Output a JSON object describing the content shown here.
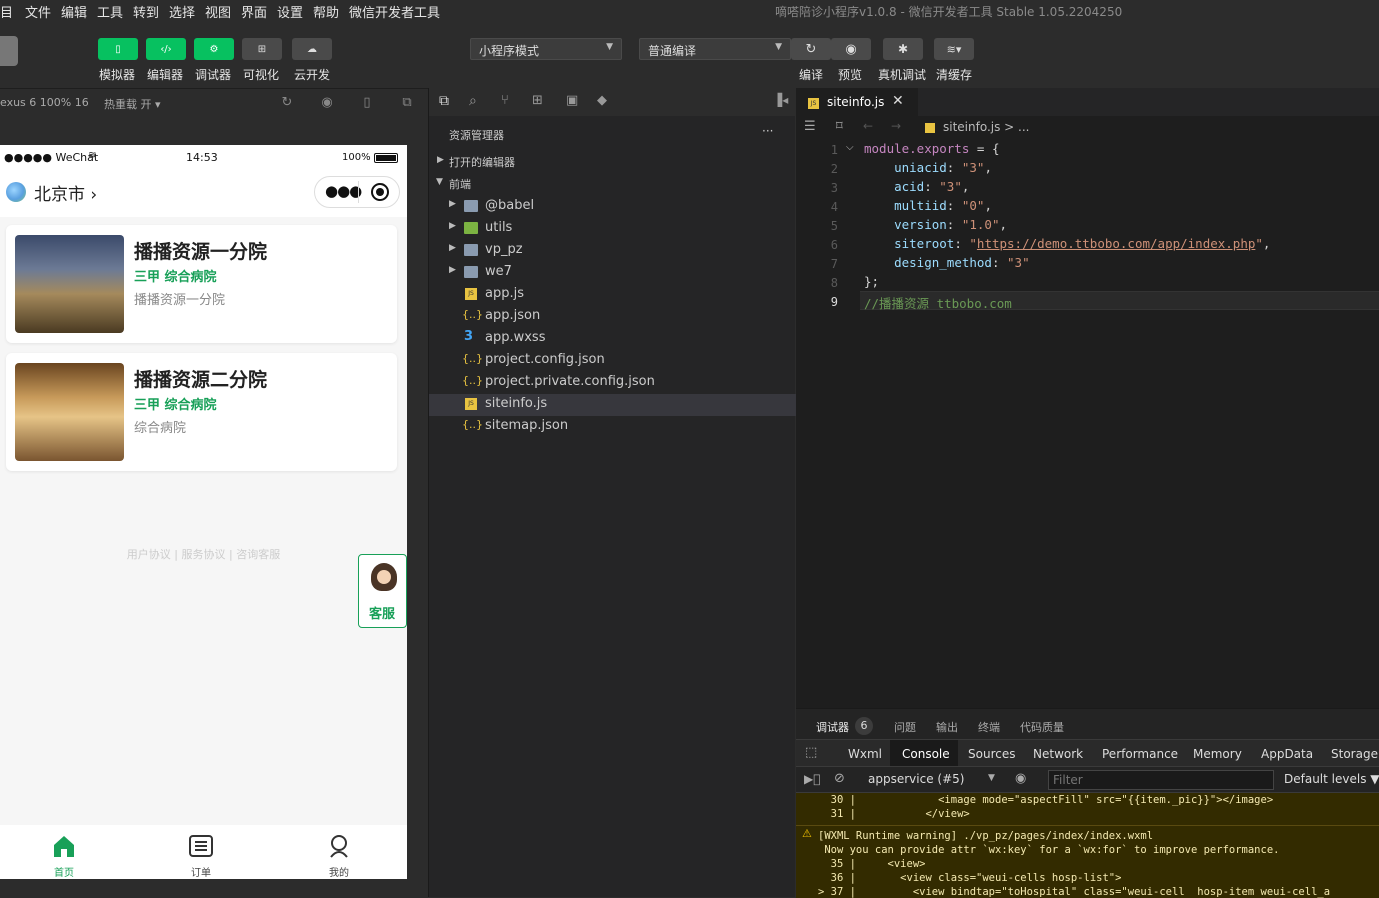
{
  "menubar": {
    "items": [
      "目",
      "文件",
      "编辑",
      "工具",
      "转到",
      "选择",
      "视图",
      "界面",
      "设置",
      "帮助",
      "微信开发者工具"
    ],
    "window_title": "嘀嗒陪诊小程序v1.0.8 - 微信开发者工具 Stable 1.05.2204250"
  },
  "toolbar": {
    "left_buttons": [
      {
        "label": "模拟器",
        "icon": "phone-icon"
      },
      {
        "label": "编辑器",
        "icon": "code-icon"
      },
      {
        "label": "调试器",
        "icon": "debug-icon"
      },
      {
        "label": "可视化",
        "icon": "layout-icon"
      },
      {
        "label": "云开发",
        "icon": "cloud-icon"
      }
    ],
    "mode_select": "小程序模式",
    "compile_select": "普通编译",
    "right_buttons": [
      {
        "label": "编译",
        "icon": "refresh-icon"
      },
      {
        "label": "预览",
        "icon": "eye-icon"
      },
      {
        "label": "真机调试",
        "icon": "bug-icon"
      },
      {
        "label": "清缓存",
        "icon": "layers-icon"
      }
    ]
  },
  "simbar": {
    "device": "exus 6 100% 16",
    "hotreload": "热重载 开"
  },
  "phone": {
    "status": {
      "carrier": "●●●●● WeChat",
      "time": "14:53",
      "battery": "100%"
    },
    "city": "北京市",
    "cards": [
      {
        "title": "播播资源一分院",
        "tags": "三甲  综合病院",
        "desc": "播播资源一分院"
      },
      {
        "title": "播播资源二分院",
        "tags": "三甲  综合病院",
        "desc": "综合病院"
      }
    ],
    "footer_links": "用户协议 | 服务协议 | 咨询客服",
    "kefu_label": "客服",
    "tabs": [
      {
        "label": "首页",
        "icon": "home-icon",
        "active": true
      },
      {
        "label": "订单",
        "icon": "list-icon",
        "active": false
      },
      {
        "label": "我的",
        "icon": "user-icon",
        "active": false
      }
    ]
  },
  "explorer": {
    "title": "资源管理器",
    "more": "···",
    "open_editors": "打开的编辑器",
    "project": "前端",
    "files": [
      {
        "name": "@babel",
        "type": "folder"
      },
      {
        "name": "utils",
        "type": "folder-green"
      },
      {
        "name": "vp_pz",
        "type": "folder"
      },
      {
        "name": "we7",
        "type": "folder"
      },
      {
        "name": "app.js",
        "type": "js"
      },
      {
        "name": "app.json",
        "type": "json"
      },
      {
        "name": "app.wxss",
        "type": "css"
      },
      {
        "name": "project.config.json",
        "type": "json"
      },
      {
        "name": "project.private.config.json",
        "type": "json"
      },
      {
        "name": "siteinfo.js",
        "type": "js",
        "selected": true
      },
      {
        "name": "sitemap.json",
        "type": "json"
      }
    ]
  },
  "editor": {
    "tab": "siteinfo.js",
    "breadcrumb": "siteinfo.js > ...",
    "lines": [
      {
        "n": "1",
        "parts": [
          [
            "kw",
            "module.exports"
          ],
          [
            "",
            "= {"
          ]
        ]
      },
      {
        "n": "2",
        "parts": [
          [
            "",
            "    "
          ],
          [
            "pr",
            "uniacid"
          ],
          [
            "",
            ": "
          ],
          [
            "st",
            "\"3\""
          ],
          [
            "",
            ","
          ]
        ]
      },
      {
        "n": "3",
        "parts": [
          [
            "",
            "    "
          ],
          [
            "pr",
            "acid"
          ],
          [
            "",
            ": "
          ],
          [
            "st",
            "\"3\""
          ],
          [
            "",
            ","
          ]
        ]
      },
      {
        "n": "4",
        "parts": [
          [
            "",
            "    "
          ],
          [
            "pr",
            "multiid"
          ],
          [
            "",
            ": "
          ],
          [
            "st",
            "\"0\""
          ],
          [
            "",
            ","
          ]
        ]
      },
      {
        "n": "5",
        "parts": [
          [
            "",
            "    "
          ],
          [
            "pr",
            "version"
          ],
          [
            "",
            ": "
          ],
          [
            "st",
            "\"1.0\""
          ],
          [
            "",
            ","
          ]
        ]
      },
      {
        "n": "6",
        "parts": [
          [
            "",
            "    "
          ],
          [
            "pr",
            "siteroot"
          ],
          [
            "",
            ": "
          ],
          [
            "st",
            "\""
          ],
          [
            "url",
            "https://demo.ttbobo.com/app/index.php"
          ],
          [
            "st",
            "\""
          ],
          [
            "",
            ","
          ]
        ]
      },
      {
        "n": "7",
        "parts": [
          [
            "",
            "    "
          ],
          [
            "pr",
            "design_method"
          ],
          [
            "",
            ": "
          ],
          [
            "st",
            "\"3\""
          ]
        ]
      },
      {
        "n": "8",
        "parts": [
          [
            "",
            "};"
          ]
        ]
      },
      {
        "n": "9",
        "parts": [
          [
            "cm",
            "//播播资源 ttbobo.com"
          ]
        ]
      }
    ]
  },
  "debug": {
    "tabs": [
      "调试器",
      "6",
      "问题",
      "输出",
      "终端",
      "代码质量"
    ],
    "devtools_tabs": [
      "Wxml",
      "Console",
      "Sources",
      "Network",
      "Performance",
      "Memory",
      "AppData",
      "Storage"
    ],
    "context": "appservice (#5)",
    "filter_placeholder": "Filter",
    "levels": "Default levels ▼",
    "console_lines": [
      "  30 |             <image mode=\"aspectFill\" src=\"{{item._pic}}\"></image>",
      "  31 |           </view>",
      "[WXML Runtime warning] ./vp_pz/pages/index/index.wxml",
      " Now you can provide attr `wx:key` for a `wx:for` to improve performance.",
      "  35 |     <view>",
      "  36 |       <view class=\"weui-cells hosp-list\">",
      "> 37 |         <view bindtap=\"toHospital\" class=\"weui-cell  hosp-item weui-cell_a"
    ]
  }
}
